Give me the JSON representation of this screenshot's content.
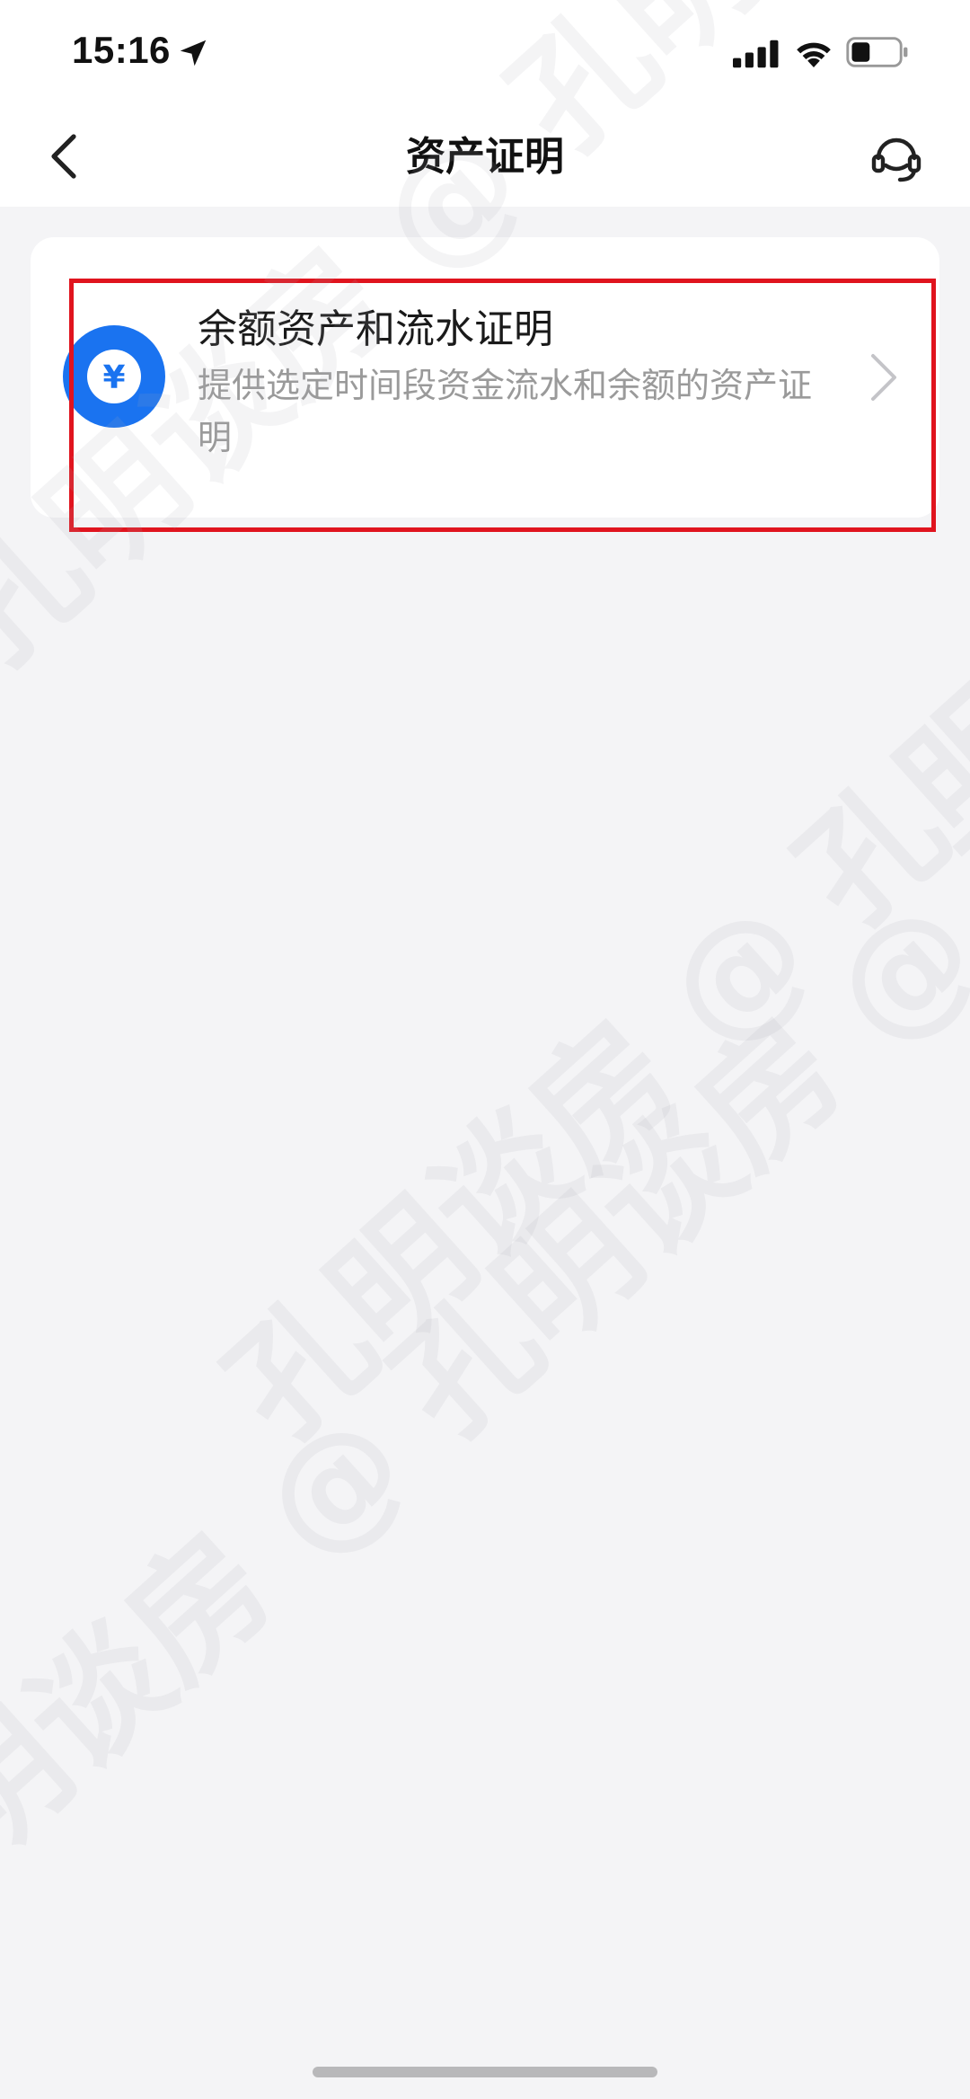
{
  "status_bar": {
    "time": "15:16"
  },
  "nav": {
    "title": "资产证明"
  },
  "list": {
    "items": [
      {
        "title": "余额资产和流水证明",
        "description": "提供选定时间段资金流水和余额的资产证明",
        "icon_symbol": "¥",
        "icon_name": "yuan-coin-icon"
      }
    ]
  },
  "watermark": {
    "text": "孔明谈房 @ 孔明谈房 @ 孔明谈房"
  },
  "colors": {
    "accent": "#1a73f0",
    "highlight_border": "#e0141e",
    "background": "#f4f4f6"
  }
}
